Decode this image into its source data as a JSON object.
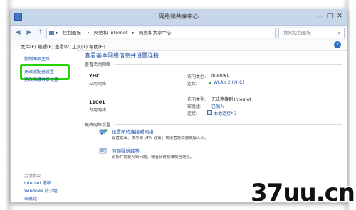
{
  "window": {
    "title": "网络和共享中心",
    "min": "—",
    "max": "□",
    "close": "✕"
  },
  "address": {
    "back": "◀",
    "forward": "▶",
    "up": "↑",
    "segments": [
      "▸",
      "控制面板",
      "▸",
      "网络和 Internet",
      "▸",
      "网络和共享中心"
    ],
    "search_placeholder": "搜索控制面板",
    "refresh": "↻",
    "dropdown": "▾"
  },
  "menu": {
    "items": [
      "文件(F)",
      "编辑(E)",
      "查看(V)",
      "工具(T)",
      "帮助(H)"
    ],
    "help": "?"
  },
  "sidebar": {
    "home": "控制面板主页",
    "change_adapter": "更改适配器设置",
    "change_advanced": "更改高级共享设置",
    "see_also": "另请参阅",
    "links": [
      "Internet 选项",
      "Windows 防火墙",
      "家庭组"
    ]
  },
  "main": {
    "title": "查看基本网络信息并设置连接",
    "active_label": "查看活动网络",
    "networks": [
      {
        "name": "YHC",
        "type": "公用网络",
        "access_key": "访问类型:",
        "access_val": "Internet",
        "conn_key": "连接:",
        "conn_val": "WLAN 2 (YHC)"
      },
      {
        "name": "11001",
        "type": "专用网络",
        "access_key": "访问类型:",
        "access_val": "无法连接到 Internet",
        "home_key": "家庭组:",
        "home_val": "已加入",
        "conn_key": "连接:",
        "conn_val": "本地连接* 3"
      }
    ],
    "change_settings_label": "更改网络设置",
    "tasks": [
      {
        "link": "设置新的连接或网络",
        "desc": "设置宽带、拨号或 VPN 连接；或设置路由器或接入点。"
      },
      {
        "link": "问题疑难解答",
        "desc": "诊断并修复网络问题，或者获得疑难解答信息。"
      }
    ]
  },
  "watermark": "37uu.cn",
  "colors": {
    "highlight": "#22d400",
    "link": "#1a50a8",
    "title_blue": "#1f4e9e"
  }
}
